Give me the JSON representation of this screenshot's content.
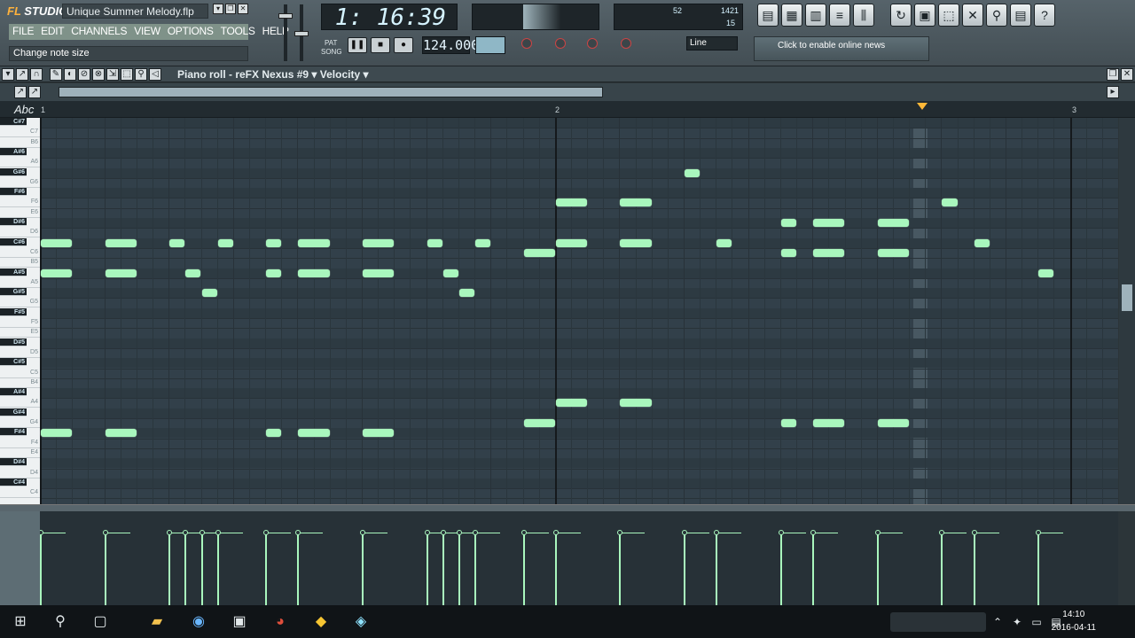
{
  "app": {
    "logo_prefix": "FL",
    "logo_suffix": "STUDIO",
    "file_title": "Unique Summer Melody.flp"
  },
  "menu": [
    "FILE",
    "EDIT",
    "CHANNELS",
    "VIEW",
    "OPTIONS",
    "TOOLS",
    "HELP"
  ],
  "hint": "Change note size",
  "transport": {
    "time": "1: 16:39",
    "tempo": "124.000",
    "pat": "PAT",
    "song": "SONG"
  },
  "meters": {
    "cpu": "52",
    "mem": "1421",
    "poly": "15"
  },
  "snap": "Line",
  "news": "Click to enable online news",
  "piano_roll": {
    "title": "Piano roll - reFX Nexus #9",
    "target": "Velocity",
    "abc": "Abc"
  },
  "ruler": {
    "bars": [
      "1",
      "2",
      "3"
    ]
  },
  "keys": [
    "C#7",
    "C7",
    "B6",
    "A#6",
    "A6",
    "G#6",
    "G6",
    "F#6",
    "F6",
    "E6",
    "D#6",
    "D6",
    "C#6",
    "C6",
    "B5",
    "A#5",
    "A5",
    "G#5",
    "G5",
    "F#5",
    "F5",
    "E5",
    "D#5",
    "D5",
    "C#5",
    "C5",
    "B4",
    "A#4",
    "A4",
    "G#4",
    "G4",
    "F#4",
    "F4",
    "E4",
    "D#4",
    "D4",
    "C#4",
    "C4"
  ],
  "notes": [
    {
      "key": "C#6",
      "start": 0,
      "len": 2
    },
    {
      "key": "C#6",
      "start": 4,
      "len": 2
    },
    {
      "key": "C#6",
      "start": 8,
      "len": 1
    },
    {
      "key": "C#6",
      "start": 11,
      "len": 1
    },
    {
      "key": "C#6",
      "start": 14,
      "len": 1
    },
    {
      "key": "C#6",
      "start": 16,
      "len": 2
    },
    {
      "key": "C#6",
      "start": 20,
      "len": 2
    },
    {
      "key": "C#6",
      "start": 24,
      "len": 1
    },
    {
      "key": "C#6",
      "start": 27,
      "len": 1
    },
    {
      "key": "A#5",
      "start": 0,
      "len": 2
    },
    {
      "key": "A#5",
      "start": 4,
      "len": 2
    },
    {
      "key": "A#5",
      "start": 9,
      "len": 1
    },
    {
      "key": "A#5",
      "start": 14,
      "len": 1
    },
    {
      "key": "A#5",
      "start": 16,
      "len": 2
    },
    {
      "key": "A#5",
      "start": 20,
      "len": 2
    },
    {
      "key": "A#5",
      "start": 25,
      "len": 1
    },
    {
      "key": "G#5",
      "start": 10,
      "len": 1
    },
    {
      "key": "G#5",
      "start": 26,
      "len": 1
    },
    {
      "key": "F#4",
      "start": 0,
      "len": 2
    },
    {
      "key": "F#4",
      "start": 4,
      "len": 2
    },
    {
      "key": "F#4",
      "start": 14,
      "len": 1
    },
    {
      "key": "F#4",
      "start": 16,
      "len": 2
    },
    {
      "key": "F#4",
      "start": 20,
      "len": 2
    },
    {
      "key": "C6",
      "start": 30,
      "len": 2
    },
    {
      "key": "C#6",
      "start": 32,
      "len": 2
    },
    {
      "key": "C#6",
      "start": 36,
      "len": 2
    },
    {
      "key": "F6",
      "start": 32,
      "len": 2
    },
    {
      "key": "F6",
      "start": 36,
      "len": 2
    },
    {
      "key": "G#6",
      "start": 40,
      "len": 1
    },
    {
      "key": "C#6",
      "start": 42,
      "len": 1
    },
    {
      "key": "A4",
      "start": 32,
      "len": 2
    },
    {
      "key": "A4",
      "start": 36,
      "len": 2
    },
    {
      "key": "G4",
      "start": 30,
      "len": 2
    },
    {
      "key": "D#6",
      "start": 46,
      "len": 1
    },
    {
      "key": "D#6",
      "start": 48,
      "len": 2
    },
    {
      "key": "D#6",
      "start": 52,
      "len": 2
    },
    {
      "key": "C6",
      "start": 46,
      "len": 1
    },
    {
      "key": "C6",
      "start": 48,
      "len": 2
    },
    {
      "key": "C6",
      "start": 52,
      "len": 2
    },
    {
      "key": "G4",
      "start": 46,
      "len": 1
    },
    {
      "key": "G4",
      "start": 48,
      "len": 2
    },
    {
      "key": "G4",
      "start": 52,
      "len": 2
    },
    {
      "key": "F6",
      "start": 56,
      "len": 1
    },
    {
      "key": "C#6",
      "start": 58,
      "len": 1
    },
    {
      "key": "A#5",
      "start": 62,
      "len": 1
    }
  ],
  "velocity_steps": [
    0,
    4,
    8,
    9,
    10,
    11,
    14,
    16,
    20,
    24,
    25,
    26,
    27,
    30,
    32,
    36,
    40,
    42,
    46,
    48,
    52,
    56,
    58,
    62
  ],
  "taskbar": {
    "time": "14:10",
    "date": "2016-04-11"
  }
}
